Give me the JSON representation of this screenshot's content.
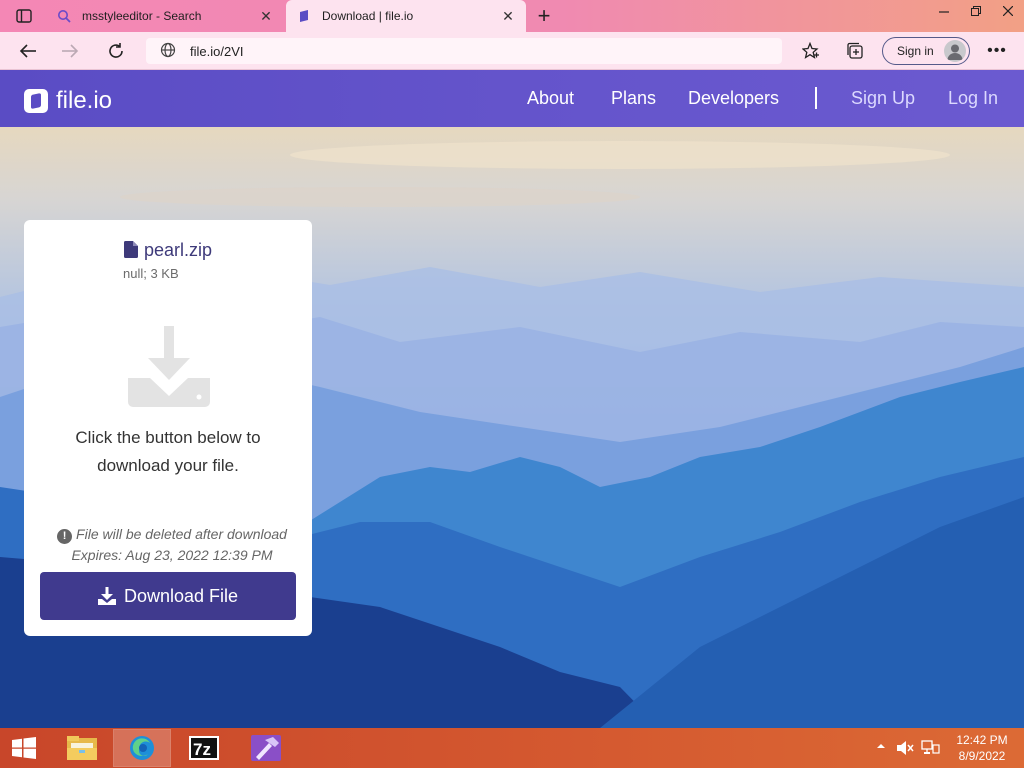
{
  "browser": {
    "tabs": [
      {
        "title": "msstyleeditor - Search",
        "icon": "search-icon"
      },
      {
        "title": "Download | file.io",
        "icon": "fileio-favicon",
        "active": true
      }
    ],
    "address": "file.io/2VI",
    "signin_label": "Sign in",
    "window_controls": [
      "minimize",
      "restore",
      "close"
    ]
  },
  "site": {
    "logo_text": "file.io",
    "nav": {
      "about": "About",
      "plans": "Plans",
      "developers": "Developers",
      "sign_up": "Sign Up",
      "log_in": "Log In"
    }
  },
  "card": {
    "file_name": "pearl.zip",
    "file_meta": "null; 3 KB",
    "message": "Click the button below to download your file.",
    "note_delete": "File will be deleted after download",
    "note_expires": "Expires: Aug 23, 2022 12:39 PM",
    "download_label": "Download File"
  },
  "taskbar": {
    "apps": [
      "file-explorer",
      "microsoft-edge",
      "7-zip",
      "visual-studio"
    ],
    "clock_time": "12:42 PM",
    "clock_date": "8/9/2022"
  },
  "colors": {
    "tabstrip": "#f487b5",
    "toolbar": "#fde3ef",
    "header": "#5a4cc4",
    "button": "#403a8e",
    "taskbar": "#c8462a"
  }
}
